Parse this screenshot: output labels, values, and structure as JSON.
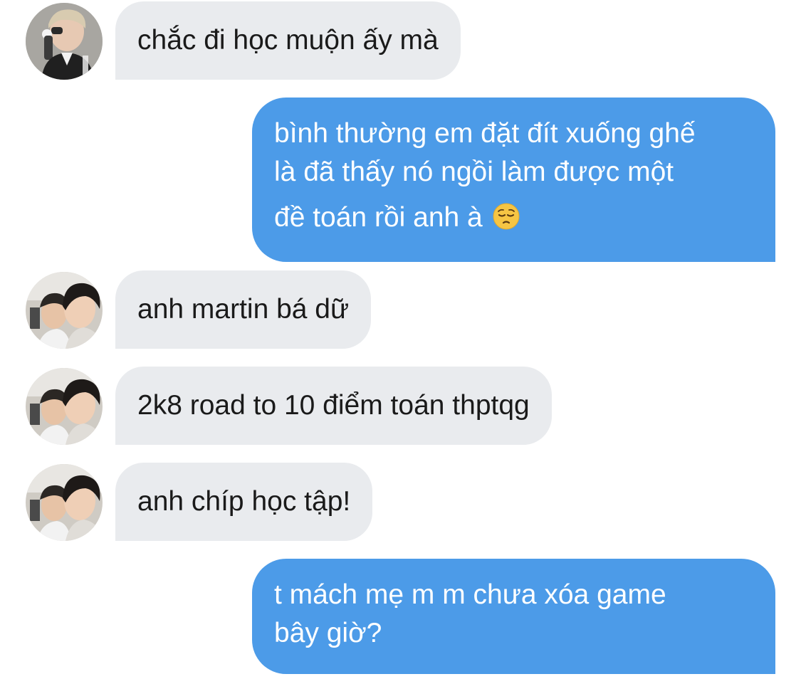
{
  "conversation": {
    "messages": [
      {
        "sender": "contact_1",
        "direction": "incoming",
        "lines": [
          "chắc đi học muộn ấy mà"
        ]
      },
      {
        "sender": "me",
        "direction": "outgoing",
        "lines": [
          "bình thường em đặt đít xuống ghế",
          "là đã thấy nó ngồi làm được một",
          "đề toán rồi anh à"
        ],
        "trailing_icon": "pensive-face-emoji"
      },
      {
        "sender": "contact_2",
        "direction": "incoming",
        "lines": [
          "anh martin bá dữ"
        ]
      },
      {
        "sender": "contact_2",
        "direction": "incoming",
        "lines": [
          "2k8 road to 10 điểm toán thptqg"
        ]
      },
      {
        "sender": "contact_2",
        "direction": "incoming",
        "lines": [
          "anh chíp học tập!"
        ]
      },
      {
        "sender": "me",
        "direction": "outgoing",
        "lines": [
          "t mách mẹ m m chưa xóa game",
          "bây giờ?"
        ]
      }
    ]
  },
  "colors": {
    "incoming_bubble": "#e9ebee",
    "outgoing_bubble": "#4c9be8",
    "incoming_text": "#1a1a1a",
    "outgoing_text": "#ffffff",
    "background": "#ffffff"
  }
}
